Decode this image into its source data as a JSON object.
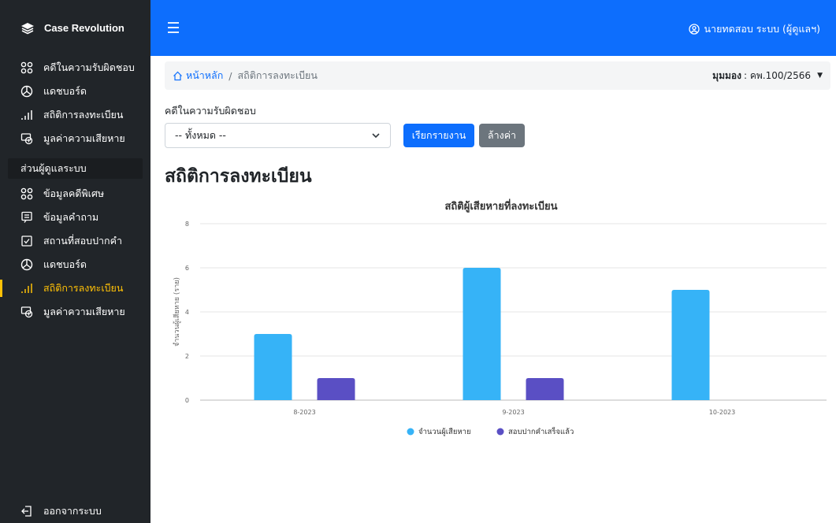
{
  "app": {
    "brand": "Case Revolution"
  },
  "topbar": {
    "user_label": "นายทดสอบ ระบบ (ผู้ดูแลฯ)"
  },
  "sidebar": {
    "items_top": [
      {
        "label": "คดีในความรับผิดชอบ",
        "icon": "circles-icon"
      },
      {
        "label": "แดชบอร์ด",
        "icon": "pie-chart-icon"
      },
      {
        "label": "สถิติการลงทะเบียน",
        "icon": "bar-chart-icon"
      },
      {
        "label": "มูลค่าความเสียหาย",
        "icon": "money-icon"
      }
    ],
    "section_title": "ส่วนผู้ดูแลระบบ",
    "items_admin": [
      {
        "label": "ข้อมูลคดีพิเศษ",
        "icon": "circles-icon"
      },
      {
        "label": "ข้อมูลคำถาม",
        "icon": "chat-icon"
      },
      {
        "label": "สถานที่สอบปากคำ",
        "icon": "check-square-icon"
      },
      {
        "label": "แดชบอร์ด",
        "icon": "pie-chart-icon"
      },
      {
        "label": "สถิติการลงทะเบียน",
        "icon": "bar-chart-icon",
        "active": true
      },
      {
        "label": "มูลค่าความเสียหาย",
        "icon": "money-icon"
      }
    ],
    "logout_label": "ออกจากระบบ"
  },
  "breadcrumb": {
    "home": "หน้าหลัก",
    "current": "สถิติการลงทะเบียน"
  },
  "mode": {
    "label": "มุมมอง",
    "value": ": คพ.100/2566"
  },
  "filter": {
    "label": "คดีในความรับผิดชอบ",
    "selected": "-- ทั้งหมด --",
    "submit_label": "เรียกรายงาน",
    "reset_label": "ล้างค่า"
  },
  "page_title": "สถิติการลงทะเบียน",
  "colors": {
    "series1": "#36b3f7",
    "series2": "#5a4fc4",
    "primary": "#0d6efd",
    "sidebar": "#212529",
    "active": "#ffc107"
  },
  "chart_data": {
    "type": "bar",
    "title": "สถิติผู้เสียหายที่ลงทะเบียน",
    "ylabel": "จำนวนผู้เสียหาย (ราย)",
    "xlabel": "",
    "categories": [
      "8-2023",
      "9-2023",
      "10-2023"
    ],
    "series": [
      {
        "name": "จำนวนผู้เสียหาย",
        "values": [
          3,
          6,
          5
        ]
      },
      {
        "name": "สอบปากคำเสร็จแล้ว",
        "values": [
          1,
          1,
          0
        ]
      }
    ],
    "ylim": [
      0,
      8
    ],
    "yticks": [
      0,
      2,
      4,
      6,
      8
    ],
    "grid": true,
    "legend": "bottom"
  }
}
